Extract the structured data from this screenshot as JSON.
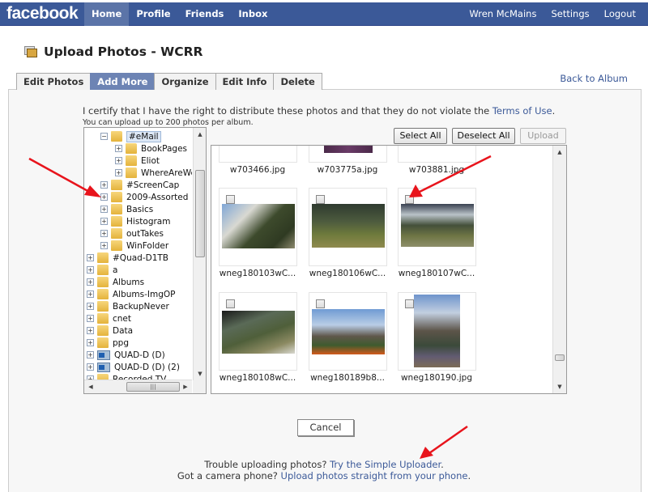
{
  "topbar": {
    "logo": "facebook",
    "nav": [
      "Home",
      "Profile",
      "Friends",
      "Inbox"
    ],
    "active_nav": "Home",
    "user_name": "Wren McMains",
    "settings": "Settings",
    "logout": "Logout",
    "color": "#3b5998"
  },
  "page": {
    "title": "Upload Photos - WCRR",
    "back_link": "Back to Album",
    "tabs": [
      "Edit Photos",
      "Add More",
      "Organize",
      "Edit Info",
      "Delete"
    ],
    "active_tab": "Add More"
  },
  "uploader": {
    "certify_text": "I certify that I have the right to distribute these photos and that they do not violate the ",
    "terms_link": "Terms of Use",
    "certify_end": ".",
    "limit_text": "You can upload up to 200 photos per album.",
    "select_all": "Select All",
    "deselect_all": "Deselect All",
    "upload": "Upload",
    "folder_tree": [
      {
        "label": "#eMail",
        "level": 1,
        "expander": "−",
        "selected": true
      },
      {
        "label": "BookPages",
        "level": 2,
        "expander": "+"
      },
      {
        "label": "Eliot",
        "level": 2,
        "expander": "+"
      },
      {
        "label": "WhereAreWe",
        "level": 2,
        "expander": "+"
      },
      {
        "label": "#ScreenCap",
        "level": 1,
        "expander": "+"
      },
      {
        "label": "2009-Assorted",
        "level": 1,
        "expander": "+"
      },
      {
        "label": "Basics",
        "level": 1,
        "expander": "+"
      },
      {
        "label": "Histogram",
        "level": 1,
        "expander": "+"
      },
      {
        "label": "outTakes",
        "level": 1,
        "expander": "+"
      },
      {
        "label": "WinFolder",
        "level": 1,
        "expander": "+"
      },
      {
        "label": "#Quad-D1TB",
        "level": 0,
        "expander": "+"
      },
      {
        "label": "a",
        "level": 0,
        "expander": "+"
      },
      {
        "label": "Albums",
        "level": 0,
        "expander": "+"
      },
      {
        "label": "Albums-ImgOP",
        "level": 0,
        "expander": "+"
      },
      {
        "label": "BackupNever",
        "level": 0,
        "expander": "+"
      },
      {
        "label": "cnet",
        "level": 0,
        "expander": "+"
      },
      {
        "label": "Data",
        "level": 0,
        "expander": "+"
      },
      {
        "label": "ppg",
        "level": 0,
        "expander": "+"
      },
      {
        "label": "QUAD-D (D)",
        "level": 0,
        "expander": "+",
        "icon": "drive"
      },
      {
        "label": "QUAD-D (D) (2)",
        "level": 0,
        "expander": "+",
        "icon": "drive"
      },
      {
        "label": "Recorded TV",
        "level": 0,
        "expander": "+"
      }
    ],
    "photos_top_row": [
      "w703466.jpg",
      "w703775a.jpg",
      "w703881.jpg"
    ],
    "photos": [
      {
        "name": "wneg180103wC...",
        "checked": false
      },
      {
        "name": "wneg180106wC...",
        "checked": false
      },
      {
        "name": "wneg180107wC...",
        "checked": false
      },
      {
        "name": "wneg180108wC...",
        "checked": false
      },
      {
        "name": "wneg180189b8...",
        "checked": false
      },
      {
        "name": "wneg180190.jpg",
        "checked": false
      }
    ],
    "cancel": "Cancel"
  },
  "footer": {
    "trouble_text": "Trouble uploading photos? ",
    "simple_link": "Try the Simple Uploader",
    "trouble_end": ".",
    "phone_text": "Got a camera phone? ",
    "phone_link": "Upload photos straight from your phone",
    "phone_end": "."
  },
  "annotation_color": "#e8141c"
}
